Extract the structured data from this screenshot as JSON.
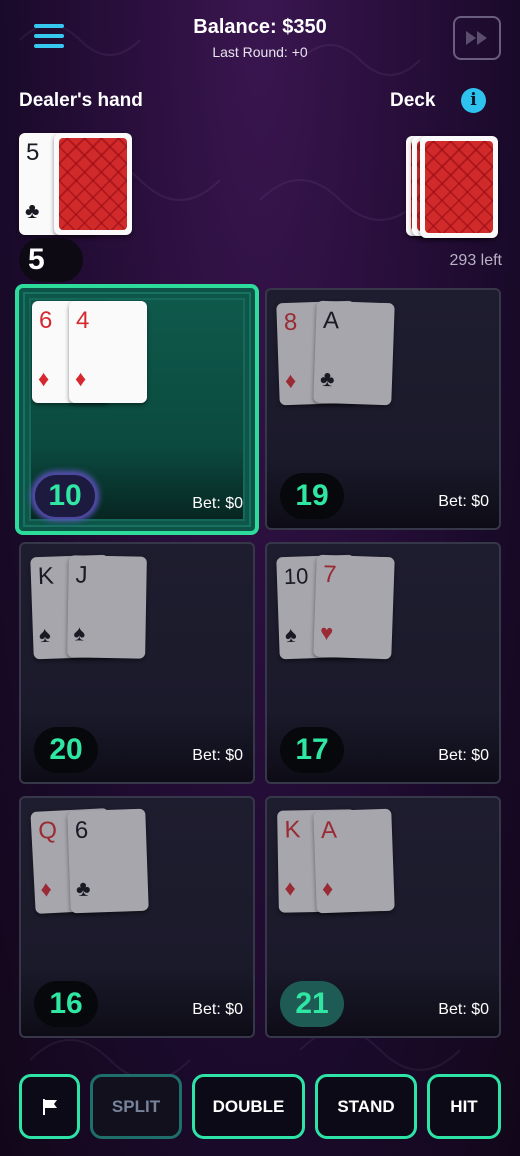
{
  "header": {
    "balance": "Balance: $350",
    "last_round": "Last Round: +0",
    "menu_icon": "hamburger-menu-icon",
    "fast_forward_icon": "fast-forward-icon"
  },
  "dealer": {
    "label": "Dealer's hand",
    "total": "5",
    "cards": [
      {
        "rank": "5",
        "suit": "♣",
        "color": "black"
      }
    ]
  },
  "deck": {
    "label": "Deck",
    "info_icon": "i",
    "remaining": "293 left"
  },
  "hands": [
    {
      "total": "10",
      "bet": "Bet: $0",
      "active": true,
      "cards": [
        {
          "rank": "6",
          "suit": "♦",
          "color": "red"
        },
        {
          "rank": "4",
          "suit": "♦",
          "color": "red"
        }
      ]
    },
    {
      "total": "19",
      "bet": "Bet: $0",
      "active": false,
      "cards": [
        {
          "rank": "8",
          "suit": "♦",
          "color": "red"
        },
        {
          "rank": "A",
          "suit": "♣",
          "color": "black"
        }
      ]
    },
    {
      "total": "20",
      "bet": "Bet: $0",
      "active": false,
      "cards": [
        {
          "rank": "K",
          "suit": "♠",
          "color": "black"
        },
        {
          "rank": "J",
          "suit": "♠",
          "color": "black"
        }
      ]
    },
    {
      "total": "17",
      "bet": "Bet: $0",
      "active": false,
      "cards": [
        {
          "rank": "10",
          "suit": "♠",
          "color": "black"
        },
        {
          "rank": "7",
          "suit": "♥",
          "color": "red"
        }
      ]
    },
    {
      "total": "16",
      "bet": "Bet: $0",
      "active": false,
      "cards": [
        {
          "rank": "Q",
          "suit": "♦",
          "color": "red"
        },
        {
          "rank": "6",
          "suit": "♣",
          "color": "black"
        }
      ]
    },
    {
      "total": "21",
      "bet": "Bet: $0",
      "active": false,
      "cards": [
        {
          "rank": "K",
          "suit": "♦",
          "color": "red"
        },
        {
          "rank": "A",
          "suit": "♦",
          "color": "red"
        }
      ]
    }
  ],
  "actions": {
    "flag_icon": "flag-icon",
    "split": "SPLIT",
    "double": "DOUBLE",
    "stand": "STAND",
    "hit": "HIT"
  },
  "colors": {
    "accent": "#2ee3a6",
    "info": "#2ec3ee",
    "card_red": "#d5292f"
  }
}
